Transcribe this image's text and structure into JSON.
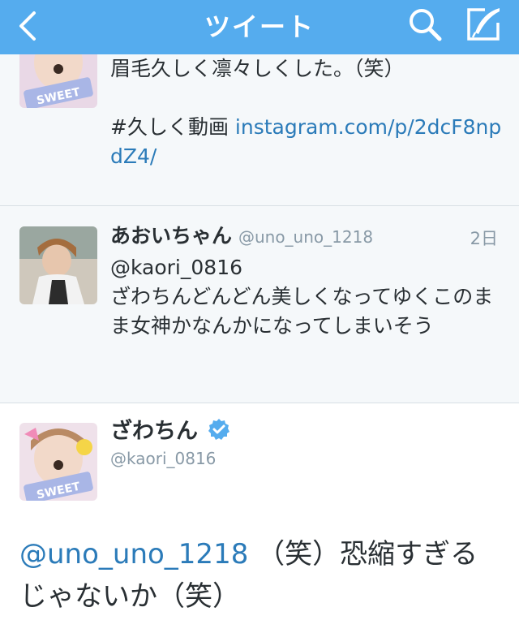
{
  "header": {
    "title": "ツイート"
  },
  "colors": {
    "brand": "#55acee",
    "link": "#2b7bb9",
    "muted": "#8899a6"
  },
  "tweet1": {
    "line1": "眉毛久しく凛々しくした。（笑）",
    "hashtag": "#久しく動画",
    "link": "instagram.com/p/2dcF8npdZ4/"
  },
  "tweet2": {
    "name": "あおいちゃん",
    "handle": "@uno_uno_1218",
    "time": "2日",
    "mention": "@kaori_0816",
    "text": "ざわちんどんどん美しくなってゆくこのまま女神かなんかになってしまいそう"
  },
  "detail": {
    "name": "ざわちん",
    "handle": "@kaori_0816",
    "mention": "@uno_uno_1218",
    "text": "（笑）恐縮すぎるじゃないか（笑）"
  },
  "icons": [
    "back-icon",
    "search-icon",
    "compose-icon",
    "verified-icon"
  ]
}
